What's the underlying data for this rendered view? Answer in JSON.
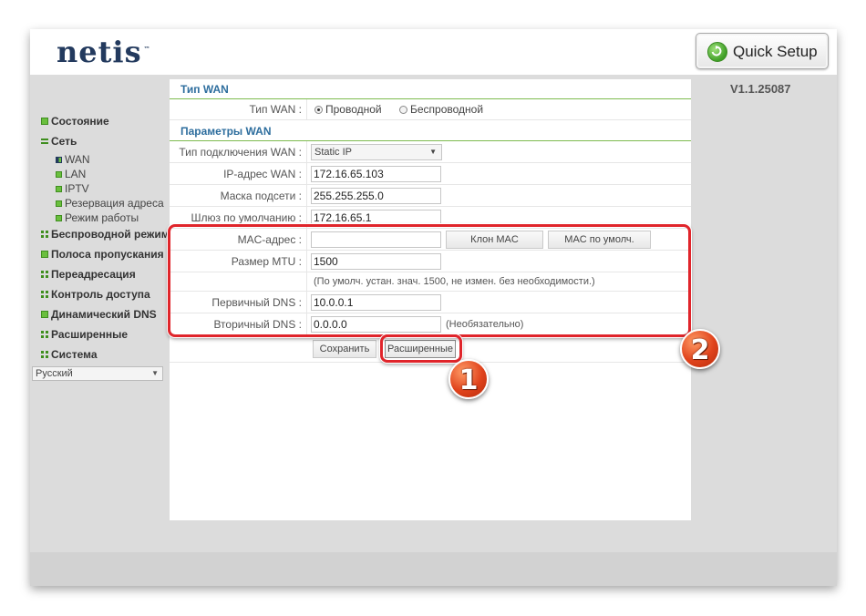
{
  "header": {
    "logo": "netis",
    "logo_mark": "™",
    "quick_setup_label": "Quick Setup",
    "version": "V1.1.25087"
  },
  "sidebar": {
    "items": [
      {
        "label": "Состояние"
      },
      {
        "label": "Сеть"
      },
      {
        "label": "Беспроводной режим"
      },
      {
        "label": "Полоса пропускания"
      },
      {
        "label": "Переадресация"
      },
      {
        "label": "Контроль доступа"
      },
      {
        "label": "Динамический DNS"
      },
      {
        "label": "Расширенные"
      },
      {
        "label": "Система"
      }
    ],
    "subitems": [
      {
        "label": "WAN"
      },
      {
        "label": "LAN"
      },
      {
        "label": "IPTV"
      },
      {
        "label": "Резервация адреса"
      },
      {
        "label": "Режим работы"
      }
    ],
    "language": "Русский"
  },
  "wan_type": {
    "title": "Тип WAN",
    "label": "Тип WAN :",
    "options": [
      "Проводной",
      "Беспроводной"
    ],
    "selected": "Проводной"
  },
  "wan_params": {
    "title": "Параметры WAN",
    "conn_type_label": "Тип подключения WAN :",
    "conn_type_value": "Static IP",
    "ip_label": "IP-адрес WAN :",
    "ip_value": "172.16.65.103",
    "mask_label": "Маска подсети :",
    "mask_value": "255.255.255.0",
    "gateway_label": "Шлюз по умолчанию :",
    "gateway_value": "172.16.65.1",
    "mac_label": "MAC-адрес :",
    "mac_value": "",
    "clone_mac_label": "Клон MAC",
    "default_mac_label": "MAC по умолч.",
    "mtu_label": "Размер MTU :",
    "mtu_value": "1500",
    "mtu_note": "(По умолч. устан. знач. 1500, не измен. без необходимости.)",
    "dns1_label": "Первичный DNS :",
    "dns1_value": "10.0.0.1",
    "dns2_label": "Вторичный DNS :",
    "dns2_value": "0.0.0.0",
    "dns2_note": "(Необязательно)"
  },
  "actions": {
    "save_label": "Сохранить",
    "advanced_label": "Расширенные"
  },
  "annotations": {
    "badge1": "1",
    "badge2": "2",
    "highlight_color": "#e0252b"
  }
}
